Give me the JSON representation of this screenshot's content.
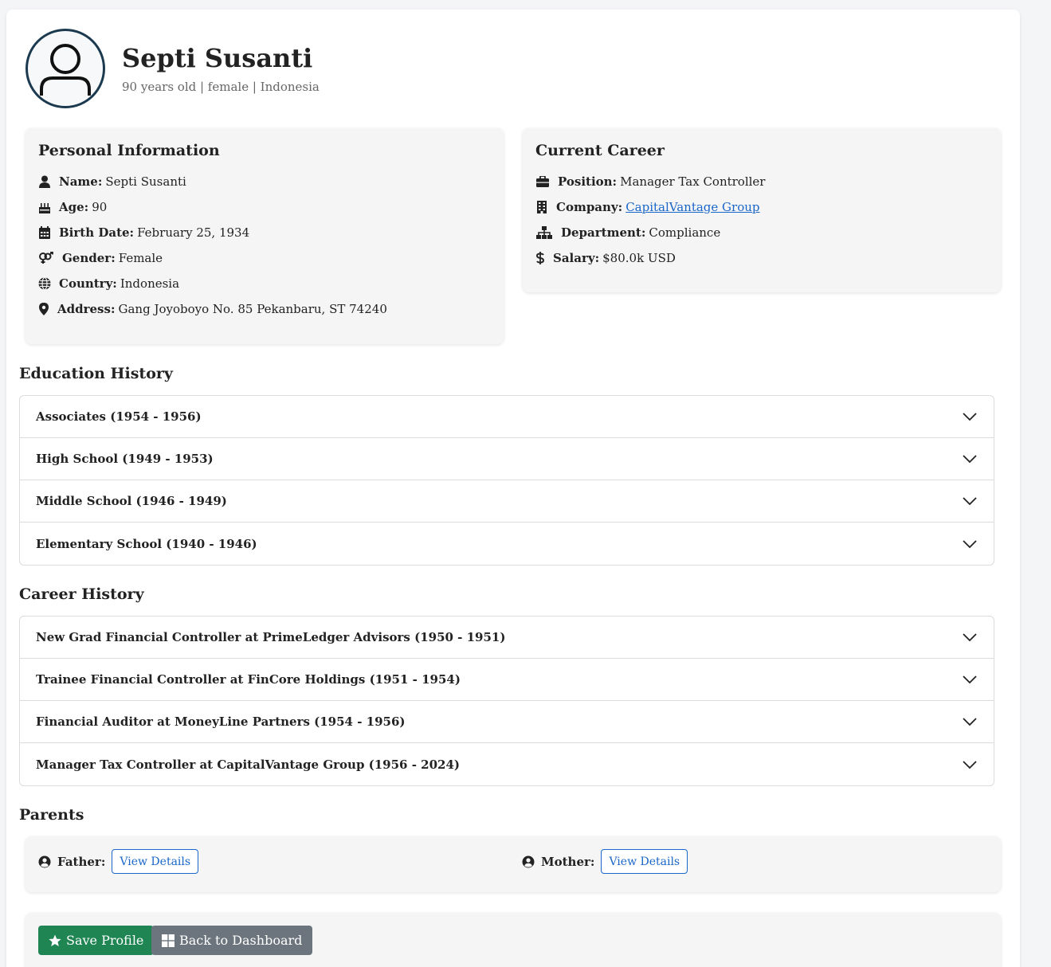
{
  "profile": {
    "name": "Septi Susanti",
    "subtitle": "90 years old | female | Indonesia"
  },
  "personal": {
    "title": "Personal Information",
    "name_label": "Name:",
    "name_value": "Septi Susanti",
    "age_label": "Age:",
    "age_value": "90",
    "birth_label": "Birth Date:",
    "birth_value": "February 25, 1934",
    "gender_label": "Gender:",
    "gender_value": "Female",
    "country_label": "Country:",
    "country_value": "Indonesia",
    "address_label": "Address:",
    "address_value": "Gang Joyoboyo No. 85 Pekanbaru, ST 74240"
  },
  "career": {
    "title": "Current Career",
    "position_label": "Position:",
    "position_value": "Manager Tax Controller",
    "company_label": "Company:",
    "company_value": "CapitalVantage Group",
    "department_label": "Department:",
    "department_value": "Compliance",
    "salary_label": "Salary:",
    "salary_value": "$80.0k USD"
  },
  "education": {
    "title": "Education History",
    "items": [
      "Associates (1954 - 1956)",
      "High School (1949 - 1953)",
      "Middle School (1946 - 1949)",
      "Elementary School (1940 - 1946)"
    ]
  },
  "career_history": {
    "title": "Career History",
    "items": [
      "New Grad Financial Controller at PrimeLedger Advisors (1950 - 1951)",
      "Trainee Financial Controller at FinCore Holdings (1951 - 1954)",
      "Financial Auditor at MoneyLine Partners (1954 - 1956)",
      "Manager Tax Controller at CapitalVantage Group (1956 - 2024)"
    ]
  },
  "parents": {
    "title": "Parents",
    "father_label": "Father:",
    "mother_label": "Mother:",
    "view_details": "View Details"
  },
  "actions": {
    "save_label": "Save Profile",
    "back_label": "Back to Dashboard"
  },
  "colors": {
    "link": "#1a66c9",
    "save_button": "#1e8553",
    "back_button": "#6c757d",
    "avatar_border": "#1c3a4f"
  },
  "icons": [
    "user-icon",
    "birthday-cake-icon",
    "calendar-icon",
    "gender-icon",
    "globe-icon",
    "map-marker-icon",
    "briefcase-icon",
    "building-icon",
    "sitemap-icon",
    "dollar-icon",
    "chevron-down-icon",
    "user-circle-icon",
    "star-icon",
    "windows-icon"
  ]
}
